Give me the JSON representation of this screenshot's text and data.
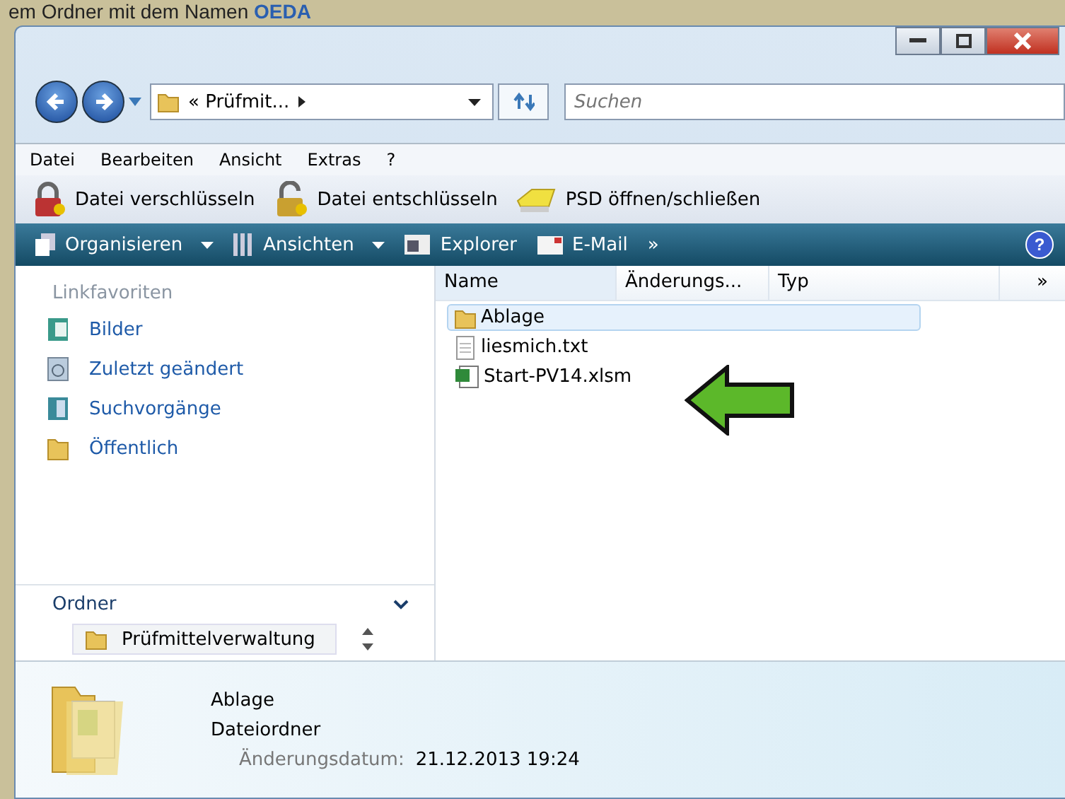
{
  "caption": {
    "text": "em Ordner mit dem Namen ",
    "highlight": "OEDA"
  },
  "address": {
    "path": "« Prüfmit...",
    "search_placeholder": "Suchen"
  },
  "menu": [
    "Datei",
    "Bearbeiten",
    "Ansicht",
    "Extras",
    "?"
  ],
  "tools": [
    {
      "label": "Datei verschlüsseln",
      "kind": "lock"
    },
    {
      "label": "Datei entschlüsseln",
      "kind": "unlock"
    },
    {
      "label": "PSD öffnen/schließen",
      "kind": "drive"
    }
  ],
  "commands": [
    {
      "label": "Organisieren",
      "kind": "pages",
      "dropdown": true
    },
    {
      "label": "Ansichten",
      "kind": "grid",
      "dropdown": true
    },
    {
      "label": "Explorer",
      "kind": "window",
      "dropdown": false
    },
    {
      "label": "E-Mail",
      "kind": "mail",
      "dropdown": false
    }
  ],
  "more": "»",
  "help": "?",
  "sidebar": {
    "heading": "Linkfavoriten",
    "items": [
      {
        "label": "Bilder",
        "kind": "pictures"
      },
      {
        "label": "Zuletzt geändert",
        "kind": "recent"
      },
      {
        "label": "Suchvorgänge",
        "kind": "search"
      },
      {
        "label": "Öffentlich",
        "kind": "folder"
      }
    ],
    "folders_heading": "Ordner",
    "folder": "Prüfmittelverwaltung"
  },
  "columns": [
    "Name",
    "Änderungs...",
    "Typ"
  ],
  "columns_more": "»",
  "files": [
    {
      "name": "Ablage",
      "kind": "folder",
      "selected": true
    },
    {
      "name": "liesmich.txt",
      "kind": "text",
      "selected": false
    },
    {
      "name": "Start-PV14.xlsm",
      "kind": "excel",
      "selected": false
    }
  ],
  "details": {
    "name": "Ablage",
    "type": "Dateiordner",
    "date_label": "Änderungsdatum:",
    "date": "21.12.2013 19:24"
  }
}
